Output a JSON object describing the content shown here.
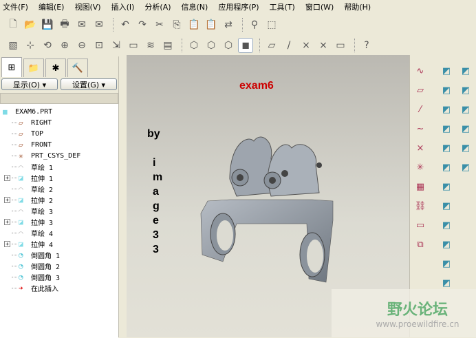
{
  "menu": [
    "文件(F)",
    "编辑(E)",
    "视图(V)",
    "插入(I)",
    "分析(A)",
    "信息(N)",
    "应用程序(P)",
    "工具(T)",
    "窗口(W)",
    "帮助(H)"
  ],
  "toolbar1": [
    "new-icon",
    "open-icon",
    "save-icon",
    "print-icon",
    "email-icon",
    "email-link-icon",
    "undo-icon",
    "redo-icon",
    "cut-icon",
    "copy-icon",
    "paste-icon",
    "paste-special-icon",
    "regenerate-icon",
    "find-icon",
    "selection-box-icon"
  ],
  "toolbar2": [
    "repaint-icon",
    "spin-center-icon",
    "orient-icon",
    "zoom-in-icon",
    "zoom-out-icon",
    "refit-icon",
    "reorient-icon",
    "named-view-icon",
    "layers-icon",
    "model-tree-settings-icon",
    "wireframe-icon",
    "hidden-line-icon",
    "no-hidden-icon",
    "shading-icon",
    "datum-plane-display-icon",
    "datum-axis-display-icon",
    "datum-point-display-icon",
    "csys-display-icon",
    "annotation-display-icon",
    "context-help-icon"
  ],
  "left": {
    "display_btn": "显示(O) ▾",
    "settings_btn": "设置(G) ▾",
    "tree": [
      {
        "label": "EXAM6.PRT",
        "type": "part",
        "level": 0
      },
      {
        "label": "RIGHT",
        "type": "plane"
      },
      {
        "label": "TOP",
        "type": "plane"
      },
      {
        "label": "FRONT",
        "type": "plane"
      },
      {
        "label": "PRT_CSYS_DEF",
        "type": "csys"
      },
      {
        "label": "草绘 1",
        "type": "sketch"
      },
      {
        "label": "拉伸 1",
        "type": "extrude",
        "expandable": true
      },
      {
        "label": "草绘 2",
        "type": "sketch"
      },
      {
        "label": "拉伸 2",
        "type": "extrude",
        "expandable": true
      },
      {
        "label": "草绘 3",
        "type": "sketch"
      },
      {
        "label": "拉伸 3",
        "type": "extrude",
        "expandable": true
      },
      {
        "label": "草绘 4",
        "type": "sketch"
      },
      {
        "label": "拉伸 4",
        "type": "extrude",
        "expandable": true
      },
      {
        "label": "倒圆角 1",
        "type": "round"
      },
      {
        "label": "倒圆角 2",
        "type": "round"
      },
      {
        "label": "倒圆角 3",
        "type": "round"
      },
      {
        "label": "在此插入",
        "type": "insert"
      }
    ]
  },
  "graphics": {
    "title": "exam6",
    "by": "by",
    "author": [
      "i",
      "m",
      "a",
      "g",
      "e",
      "3",
      "3"
    ]
  },
  "watermark": {
    "name": "野火论坛",
    "url": "www.proewildfire.cn"
  }
}
